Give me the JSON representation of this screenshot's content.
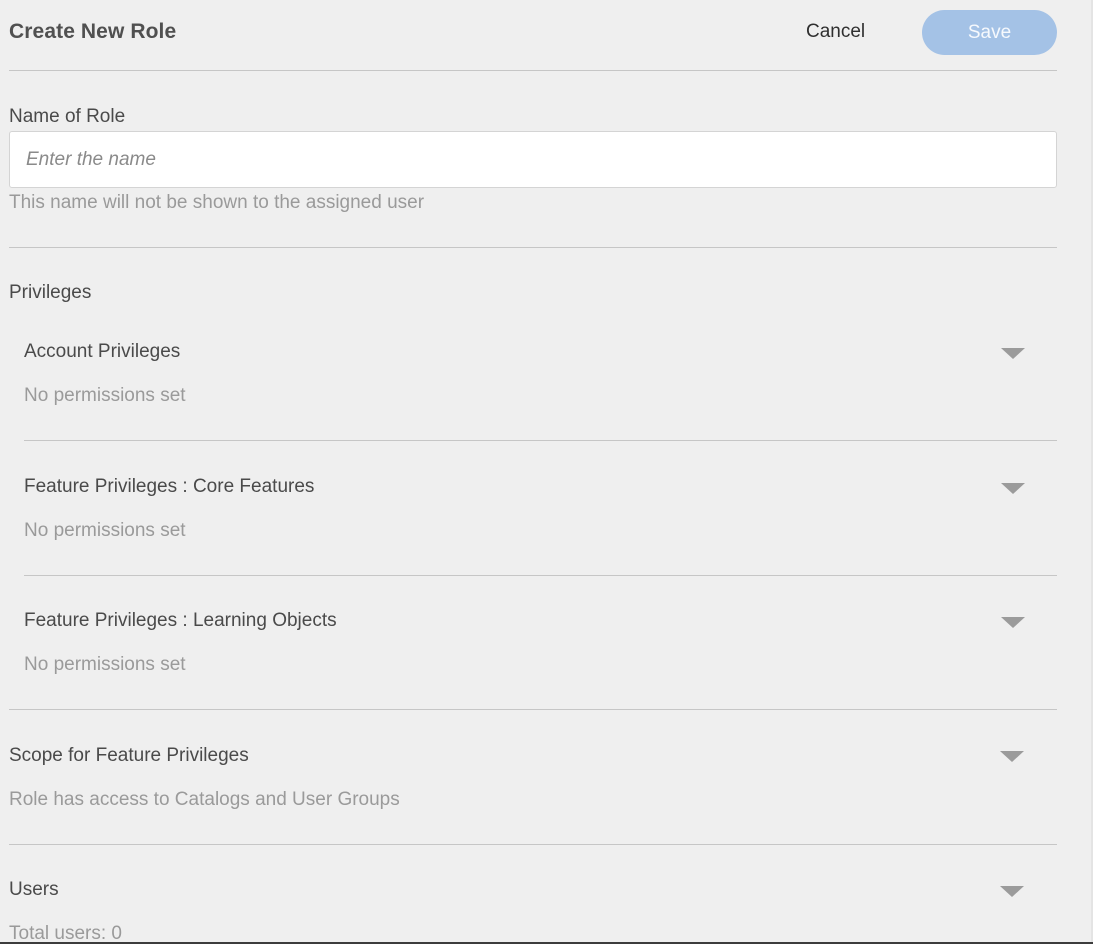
{
  "header": {
    "title": "Create New Role",
    "cancel_label": "Cancel",
    "save_label": "Save"
  },
  "name_field": {
    "label": "Name of Role",
    "placeholder": "Enter the name",
    "value": "",
    "helper": "This name will not be shown to the assigned user"
  },
  "privileges": {
    "label": "Privileges",
    "groups": [
      {
        "title": "Account Privileges",
        "summary": "No permissions set"
      },
      {
        "title": "Feature Privileges : Core Features",
        "summary": "No permissions set"
      },
      {
        "title": "Feature Privileges : Learning Objects",
        "summary": "No permissions set"
      }
    ]
  },
  "scope": {
    "title": "Scope for Feature Privileges",
    "summary": "Role has access to Catalogs and User Groups"
  },
  "users": {
    "title": "Users",
    "summary": "Total users: 0"
  },
  "icons": {
    "expand": "chevron-down-icon"
  },
  "colors": {
    "background": "#efefef",
    "save_button_disabled": "#a4c2e6",
    "divider": "#c6c6c6",
    "muted_text": "#9a9a9a"
  }
}
